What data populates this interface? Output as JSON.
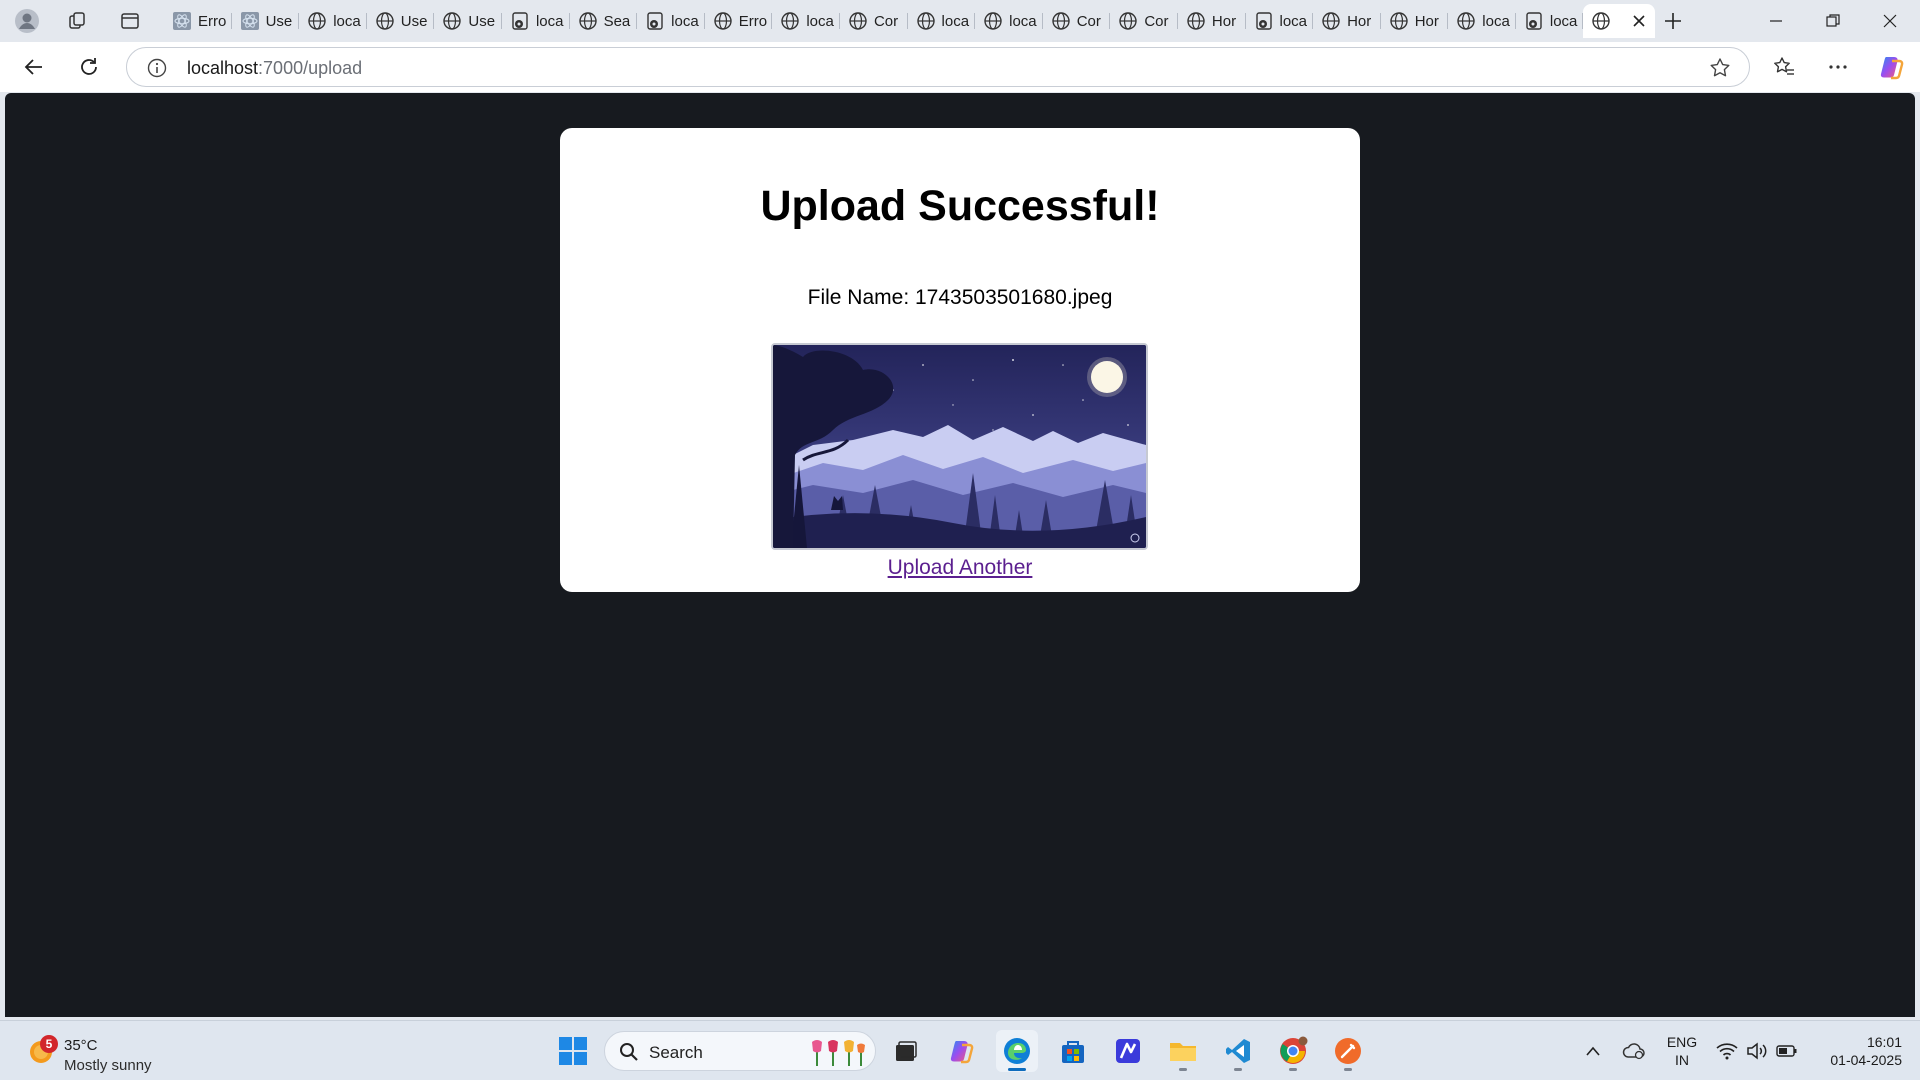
{
  "browser": {
    "tabs": [
      {
        "label": "Erro",
        "icon": "react-favicon"
      },
      {
        "label": "Use",
        "icon": "react-favicon"
      },
      {
        "label": "loca",
        "icon": "globe-favicon"
      },
      {
        "label": "Use",
        "icon": "globe-favicon"
      },
      {
        "label": "Use",
        "icon": "globe-favicon"
      },
      {
        "label": "loca",
        "icon": "cookie-favicon"
      },
      {
        "label": "Sea",
        "icon": "globe-favicon"
      },
      {
        "label": "loca",
        "icon": "cookie-favicon"
      },
      {
        "label": "Erro",
        "icon": "globe-favicon"
      },
      {
        "label": "loca",
        "icon": "globe-favicon"
      },
      {
        "label": "Cor",
        "icon": "globe-favicon"
      },
      {
        "label": "loca",
        "icon": "globe-favicon"
      },
      {
        "label": "loca",
        "icon": "globe-favicon"
      },
      {
        "label": "Cor",
        "icon": "globe-favicon"
      },
      {
        "label": "Cor",
        "icon": "globe-favicon"
      },
      {
        "label": "Hor",
        "icon": "globe-favicon"
      },
      {
        "label": "loca",
        "icon": "cookie-favicon"
      },
      {
        "label": "Hor",
        "icon": "globe-favicon"
      },
      {
        "label": "Hor",
        "icon": "globe-favicon"
      },
      {
        "label": "loca",
        "icon": "globe-favicon"
      },
      {
        "label": "loca",
        "icon": "cookie-favicon"
      }
    ],
    "active_tab": {
      "label": "",
      "icon": "globe-favicon"
    },
    "address": {
      "host": "localhost",
      "path": ":7000/upload"
    }
  },
  "page": {
    "title": "Upload Successful!",
    "file_label": "File Name:",
    "file_name": "1743503501680.jpeg",
    "image_alt": "night mountain landscape",
    "link_label": "Upload Another"
  },
  "taskbar": {
    "weather": {
      "badge": "5",
      "temp": "35°C",
      "condition": "Mostly sunny"
    },
    "search_placeholder": "Search",
    "lang": {
      "line1": "ENG",
      "line2": "IN"
    },
    "clock": {
      "time": "16:01",
      "date": "01-04-2025"
    }
  },
  "colors": {
    "page_background": "#171a1f",
    "card_background": "#ffffff",
    "link_visited": "#5b1f8f"
  }
}
